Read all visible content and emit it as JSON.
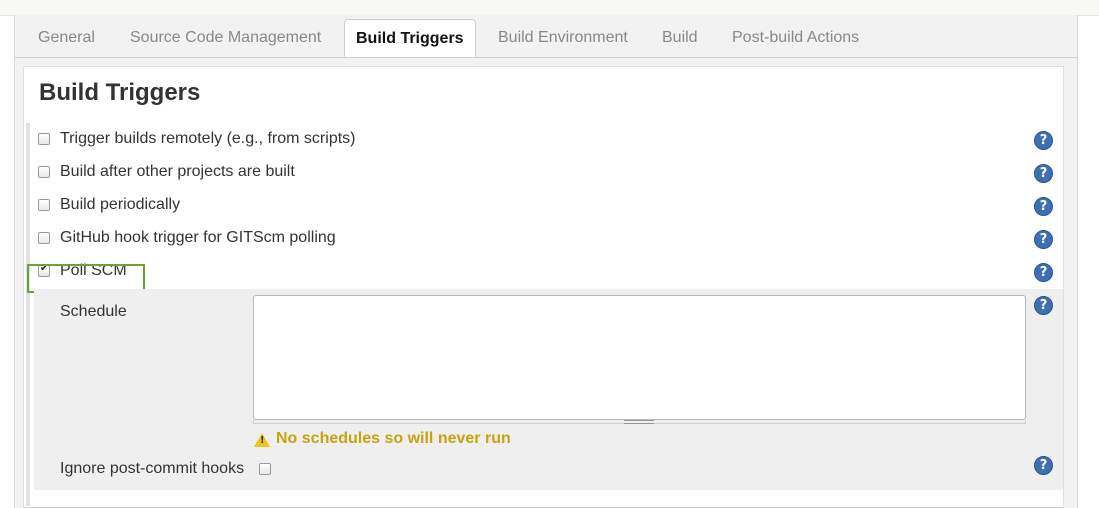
{
  "tabs": [
    {
      "label": "General"
    },
    {
      "label": "Source Code Management"
    },
    {
      "label": "Build Triggers",
      "active": true
    },
    {
      "label": "Build Environment"
    },
    {
      "label": "Build"
    },
    {
      "label": "Post-build Actions"
    }
  ],
  "section": {
    "title": "Build Triggers"
  },
  "triggers": [
    {
      "label": "Trigger builds remotely (e.g., from scripts)",
      "checked": false
    },
    {
      "label": "Build after other projects are built",
      "checked": false
    },
    {
      "label": "Build periodically",
      "checked": false
    },
    {
      "label": "GitHub hook trigger for GITScm polling",
      "checked": false
    },
    {
      "label": "Poll SCM",
      "checked": true
    }
  ],
  "poll_scm": {
    "schedule_label": "Schedule",
    "schedule_value": "",
    "warning": "No schedules so will never run",
    "ignore_hooks_label": "Ignore post-commit hooks",
    "ignore_hooks_checked": false
  },
  "icons": {
    "help": "help-icon",
    "warning": "warning-icon",
    "checkbox_checked": "checkmark"
  },
  "colors": {
    "highlight": "#6aa336",
    "warning": "#c9a20c",
    "help": "#3e6fb3",
    "active_tab_text": "#111111",
    "inactive_tab_text": "#888888"
  }
}
